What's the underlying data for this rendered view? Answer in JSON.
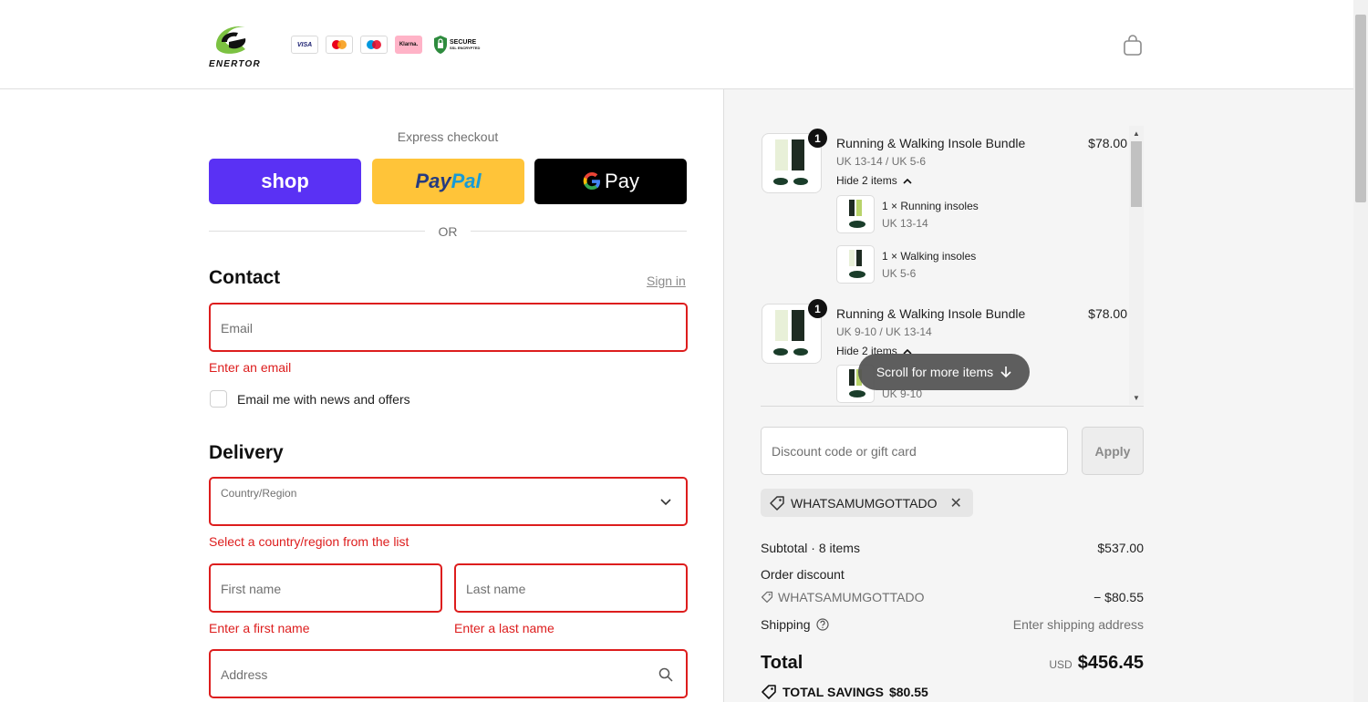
{
  "header": {
    "brand": "ENERTOR",
    "payment_badges": [
      "VISA",
      "Mastercard",
      "Maestro",
      "Klarna."
    ],
    "secure_text_1": "SECURE",
    "secure_text_2": "SSL ENCRYPTED"
  },
  "express": {
    "label": "Express checkout",
    "shop_label": "shop",
    "paypal_label_1": "Pay",
    "paypal_label_2": "Pal",
    "gpay_label": "Pay",
    "or_label": "OR"
  },
  "contact": {
    "title": "Contact",
    "signin": "Sign in",
    "email_placeholder": "Email",
    "email_error": "Enter an email",
    "newsletter_label": "Email me with news and offers"
  },
  "delivery": {
    "title": "Delivery",
    "country_label": "Country/Region",
    "country_error": "Select a country/region from the list",
    "first_name_placeholder": "First name",
    "first_name_error": "Enter a first name",
    "last_name_placeholder": "Last name",
    "last_name_error": "Enter a last name",
    "address_placeholder": "Address"
  },
  "order": {
    "items": [
      {
        "qty": "1",
        "name": "Running & Walking Insole Bundle",
        "variant": "UK 13-14 / UK 5-6",
        "price": "$78.00",
        "hide_label": "Hide 2 items",
        "sub_items": [
          {
            "name": "1 × Running insoles",
            "variant": "UK 13-14"
          },
          {
            "name": "1 × Walking insoles",
            "variant": "UK 5-6"
          }
        ]
      },
      {
        "qty": "1",
        "name": "Running & Walking Insole Bundle",
        "variant": "UK 9-10 / UK 13-14",
        "price": "$78.00",
        "hide_label": "Hide 2 items",
        "sub_items": [
          {
            "name": "",
            "variant": "UK 9-10"
          }
        ]
      }
    ],
    "scroll_hint": "Scroll for more items",
    "discount_placeholder": "Discount code or gift card",
    "apply_label": "Apply",
    "applied_code": "WHATSAMUMGOTTADO",
    "subtotal_label": "Subtotal · 8 items",
    "subtotal_value": "$537.00",
    "order_discount_label": "Order discount",
    "discount_code": "WHATSAMUMGOTTADO",
    "discount_value": "− $80.55",
    "shipping_label": "Shipping",
    "shipping_value": "Enter shipping address",
    "total_label": "Total",
    "total_currency": "USD",
    "total_value": "$456.45",
    "savings_label": "TOTAL SAVINGS",
    "savings_value": "$80.55"
  },
  "colors": {
    "error": "#dd1d1d",
    "shop": "#5a31f4",
    "paypal": "#ffc439",
    "gpay": "#000000"
  }
}
